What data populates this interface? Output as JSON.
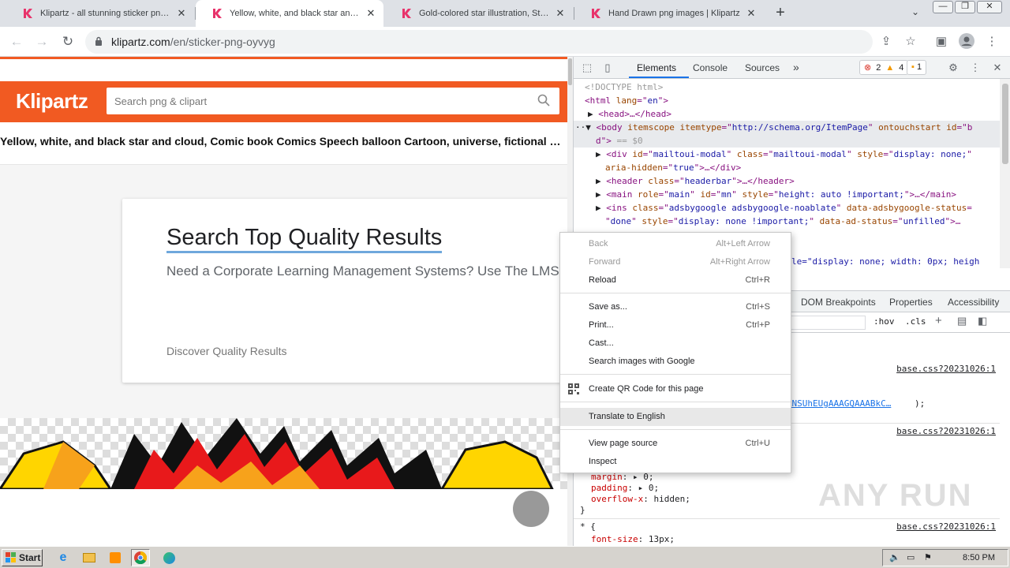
{
  "tabs": [
    {
      "title": "Klipartz - all stunning sticker png ima",
      "active": false
    },
    {
      "title": "Yellow, white, and black star and clo",
      "active": true
    },
    {
      "title": "Gold-colored star illustration, Star Do",
      "active": false
    },
    {
      "title": "Hand Drawn png images | Klipartz",
      "active": false
    }
  ],
  "toolbar": {
    "url_host": "klipartz.com",
    "url_path": "/en/sticker-png-oyvyg"
  },
  "page": {
    "logo": "Klipartz",
    "search_placeholder": "Search png & clipart",
    "title": "Yellow, white, and black star and cloud, Comic book Comics Speech balloon Cartoon, universe, fictional Character, cartoon, comics png",
    "ad": {
      "title": "Search Top Quality Results",
      "subtitle": "Need a Corporate Learning Management Systems? Use The LMS Search Tool",
      "link": "Discover Quality Results"
    }
  },
  "devtools": {
    "tabs": [
      "Elements",
      "Console",
      "Sources"
    ],
    "more": "»",
    "errors": "2",
    "warnings": "4",
    "issues": "1",
    "dom": {
      "l1": "<!DOCTYPE html>",
      "l2a": "<html ",
      "l2b": "lang",
      "l2c": "=\"",
      "l2d": "en",
      "l2e": "\">",
      "l3": "<head>…</head>",
      "l4a": "<body ",
      "l4b": "itemscope itemtype",
      "l4c": "=\"",
      "l4d": "http://schema.org/ItemPage",
      "l4e": "\" ",
      "l4f": "ontouchstart id",
      "l4g": "=\"b",
      "l5a": "d\">",
      "l5b": " == $0",
      "l6a": "<div ",
      "l6b": "id",
      "l6c": "mailtoui-modal",
      "l6d": "class",
      "l6e": "mailtoui-modal",
      "l6f": "style",
      "l6g": "display: none;",
      "l7a": "aria-hidden",
      "l7b": "true",
      "l7c": ">…</div>",
      "l8a": "<header ",
      "l8b": "class",
      "l8c": "headerbar",
      "l8d": ">…</header>",
      "l9a": "<main ",
      "l9b": "role",
      "l9c": "main",
      "l9d": "id",
      "l9e": "mn",
      "l9f": "style",
      "l9g": "height: auto !important;",
      "l9h": ">…</main>",
      "l10a": "<ins ",
      "l10b": "class",
      "l10c": "adsbygoogle adsbygoogle-noablate",
      "l10d": "data-adsbygoogle-status",
      "l11a": "done",
      "l11b": "style",
      "l11c": "display: none !important;",
      "l11d": "data-ad-status",
      "l11e": "unfilled",
      "l11f": ">…",
      "l12": "le=\"display: none; width: 0px; heigh"
    },
    "styles_tabs": [
      "DOM Breakpoints",
      "Properties",
      "Accessibility"
    ],
    "filter_hov": ":hov",
    "filter_cls": ".cls",
    "rules": [
      {
        "source": "base.css?20231026:1"
      },
      {
        "source": "base.css?20231026:1"
      },
      {
        "source": "base.css?20231026:1"
      }
    ],
    "base64_snippet": "AAAANSUhEUgAAAGQAAABkC…",
    "base64_tail": ");",
    "css_lines": {
      "margin": "margin",
      "margin_val": "0;",
      "padding": "padding",
      "padding_val": "0;",
      "overflow": "overflow-x",
      "overflow_val": "hidden;",
      "close": "}",
      "star": "* {",
      "fontsize": "font-size",
      "fontsize_val": "13px;"
    }
  },
  "context_menu": [
    {
      "label": "Back",
      "shortcut": "Alt+Left Arrow",
      "disabled": true
    },
    {
      "label": "Forward",
      "shortcut": "Alt+Right Arrow",
      "disabled": true
    },
    {
      "label": "Reload",
      "shortcut": "Ctrl+R",
      "disabled": false
    },
    {
      "label": "Save as...",
      "shortcut": "Ctrl+S",
      "disabled": false
    },
    {
      "label": "Print...",
      "shortcut": "Ctrl+P",
      "disabled": false
    },
    {
      "label": "Cast...",
      "shortcut": "",
      "disabled": false
    },
    {
      "label": "Search images with Google",
      "shortcut": "",
      "disabled": false
    },
    {
      "label": "Create QR Code for this page",
      "shortcut": "",
      "disabled": false
    },
    {
      "label": "Translate to English",
      "shortcut": "",
      "disabled": false,
      "highlighted": true
    },
    {
      "label": "View page source",
      "shortcut": "Ctrl+U",
      "disabled": false
    },
    {
      "label": "Inspect",
      "shortcut": "",
      "disabled": false
    }
  ],
  "taskbar": {
    "start": "Start",
    "clock": "8:50 PM"
  },
  "watermark": "ANY RUN",
  "colors": {
    "brand": "#f15a22",
    "accent": "#1a73e8"
  }
}
